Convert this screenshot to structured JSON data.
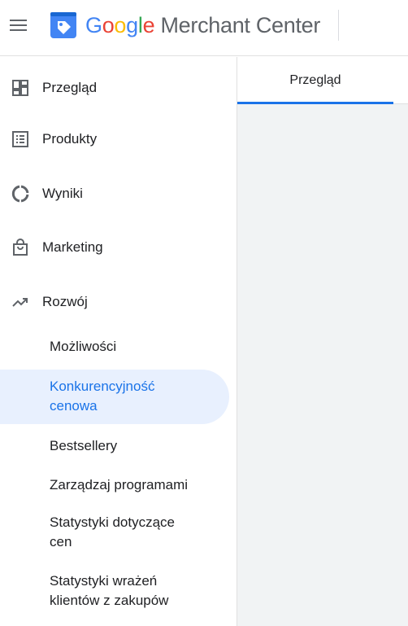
{
  "header": {
    "brand_google_letters": [
      "G",
      "o",
      "o",
      "g",
      "l",
      "e"
    ],
    "brand_product": "Merchant Center",
    "menu_icon": "hamburger-menu-icon",
    "logo_icon": "merchant-center-tag-icon"
  },
  "sidebar": {
    "items": [
      {
        "label": "Przegląd",
        "icon": "dashboard-icon"
      },
      {
        "label": "Produkty",
        "icon": "list-icon"
      },
      {
        "label": "Wyniki",
        "icon": "donut-chart-icon"
      },
      {
        "label": "Marketing",
        "icon": "shopping-bag-icon"
      },
      {
        "label": "Rozwój",
        "icon": "trending-up-icon"
      }
    ],
    "subitems": [
      {
        "label": "Możliwości",
        "active": false
      },
      {
        "label": "Konkurencyjność cenowa",
        "active": true
      },
      {
        "label": "Bestsellery",
        "active": false
      },
      {
        "label": "Zarządzaj programami",
        "active": false
      },
      {
        "label": "Statystyki dotyczące cen",
        "active": false
      },
      {
        "label": "Statystyki wrażeń klientów z zakupów",
        "active": false
      }
    ]
  },
  "main": {
    "tabs": [
      {
        "label": "Przegląd",
        "active": true
      }
    ]
  },
  "colors": {
    "accent": "#1a73e8",
    "active_bg": "#e8f0fe",
    "content_bg": "#f1f3f4",
    "icon_gray": "#5f6368"
  }
}
